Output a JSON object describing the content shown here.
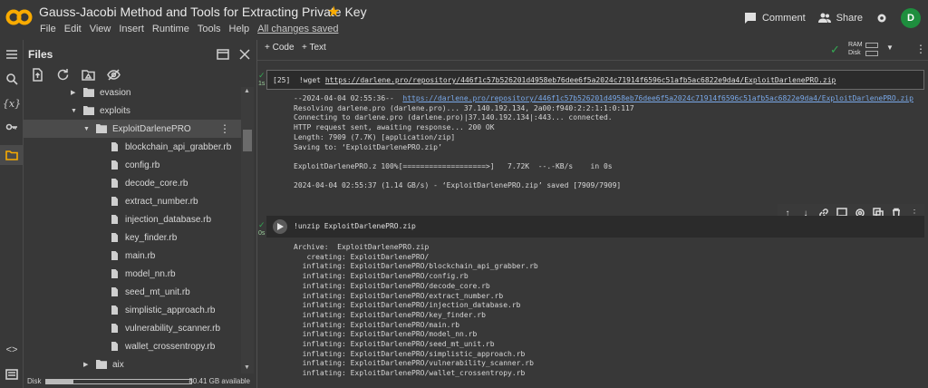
{
  "header": {
    "title": "Gauss-Jacobi Method and Tools for Extracting Private Key",
    "menu": [
      "File",
      "Edit",
      "View",
      "Insert",
      "Runtime",
      "Tools",
      "Help"
    ],
    "saved_status": "All changes saved",
    "comment_label": "Comment",
    "share_label": "Share",
    "avatar_initial": "D"
  },
  "files_panel": {
    "title": "Files",
    "tree": [
      {
        "name": "evasion",
        "type": "folder",
        "expanded": false
      },
      {
        "name": "exploits",
        "type": "folder",
        "expanded": true
      },
      {
        "name": "ExploitDarlenePRO",
        "type": "folder",
        "expanded": true,
        "selected": true
      },
      {
        "name": "blockchain_api_grabber.rb",
        "type": "file"
      },
      {
        "name": "config.rb",
        "type": "file"
      },
      {
        "name": "decode_core.rb",
        "type": "file"
      },
      {
        "name": "extract_number.rb",
        "type": "file"
      },
      {
        "name": "injection_database.rb",
        "type": "file"
      },
      {
        "name": "key_finder.rb",
        "type": "file"
      },
      {
        "name": "main.rb",
        "type": "file"
      },
      {
        "name": "model_nn.rb",
        "type": "file"
      },
      {
        "name": "seed_mt_unit.rb",
        "type": "file"
      },
      {
        "name": "simplistic_approach.rb",
        "type": "file"
      },
      {
        "name": "vulnerability_scanner.rb",
        "type": "file"
      },
      {
        "name": "wallet_crossentropy.rb",
        "type": "file"
      },
      {
        "name": "aix",
        "type": "folder",
        "expanded": false
      }
    ],
    "disk_label": "Disk",
    "disk_available": "80.41 GB available",
    "disk_used_fraction": 0.19
  },
  "toolbar": {
    "code_label": "+ Code",
    "text_label": "+ Text",
    "ram_label": "RAM",
    "disk_label": "Disk"
  },
  "cell1": {
    "exec_count": "[25]",
    "status_time": "1s",
    "command_prefix": "!wget ",
    "command_url": "https://darlene.pro/repository/446f1c57b526201d4958eb76dee6f5a2024c71914f6596c51afb5ac6822e9da4/ExploitDarlenePRO.zip",
    "output_prefix": "--2024-04-04 02:55:36--  ",
    "output_url": "https://darlene.pro/repository/446f1c57b526201d4958eb76dee6f5a2024c71914f6596c51afb5ac6822e9da4/ExploitDarlenePRO.zip",
    "output_lines": [
      "Resolving darlene.pro (darlene.pro)... 37.140.192.134, 2a00:f940:2:2:1:1:0:117",
      "Connecting to darlene.pro (darlene.pro)|37.140.192.134|:443... connected.",
      "HTTP request sent, awaiting response... 200 OK",
      "Length: 7909 (7.7K) [application/zip]",
      "Saving to: ‘ExploitDarlenePRO.zip’",
      "",
      "ExploitDarlenePRO.z 100%[===================>]   7.72K  --.-KB/s    in 0s",
      "",
      "2024-04-04 02:55:37 (1.14 GB/s) - ‘ExploitDarlenePRO.zip’ saved [7909/7909]"
    ]
  },
  "cell2": {
    "status_time": "0s",
    "command": "!unzip ExploitDarlenePRO.zip",
    "output_lines": [
      "Archive:  ExploitDarlenePRO.zip",
      "   creating: ExploitDarlenePRO/",
      "  inflating: ExploitDarlenePRO/blockchain_api_grabber.rb",
      "  inflating: ExploitDarlenePRO/config.rb",
      "  inflating: ExploitDarlenePRO/decode_core.rb",
      "  inflating: ExploitDarlenePRO/extract_number.rb",
      "  inflating: ExploitDarlenePRO/injection_database.rb",
      "  inflating: ExploitDarlenePRO/key_finder.rb",
      "  inflating: ExploitDarlenePRO/main.rb",
      "  inflating: ExploitDarlenePRO/model_nn.rb",
      "  inflating: ExploitDarlenePRO/seed_mt_unit.rb",
      "  inflating: ExploitDarlenePRO/simplistic_approach.rb",
      "  inflating: ExploitDarlenePRO/vulnerability_scanner.rb",
      "  inflating: ExploitDarlenePRO/wallet_crossentropy.rb"
    ]
  },
  "colors": {
    "background": "#383838",
    "code_bg": "#2b2b2b",
    "link": "#79a8e8",
    "star": "#f9ab00",
    "success": "#34a853",
    "avatar": "#1e8e3e"
  }
}
